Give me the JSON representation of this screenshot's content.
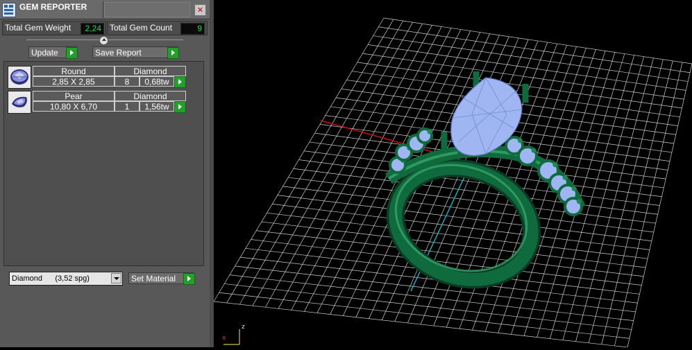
{
  "window": {
    "title": "GEM REPORTER",
    "close_glyph": "✕"
  },
  "summary": {
    "total_weight_label": "Total Gem Weight",
    "total_weight_value": "2,24",
    "total_count_label": "Total Gem Count",
    "total_count_value": "9"
  },
  "slider": {
    "icon": "slider-knob-icon"
  },
  "actions": {
    "update_label": "Update",
    "save_report_label": "Save Report"
  },
  "gems": [
    {
      "shape": "Round",
      "material": "Diamond",
      "size": "2,85 X 2,85",
      "count": "8",
      "weight": "0,68tw",
      "icon": "round-gem-icon"
    },
    {
      "shape": "Pear",
      "material": "Diamond",
      "size": "10,80 X 6,70",
      "count": "1",
      "weight": "1,56tw",
      "icon": "pear-gem-icon"
    }
  ],
  "material_select": {
    "value": "Diamond      (3,52 spg)"
  },
  "set_material_label": "Set Material",
  "viewport": {
    "axis_label": "z",
    "origin_label": "x"
  },
  "colors": {
    "panel": "#585858",
    "value_text": "#22dd44",
    "go_button": "#22a02a",
    "grid": "#d0d0d0",
    "metal": "#0f6b3e",
    "gem": "#9fb6f2",
    "x_axis": "#d01010",
    "y_axis": "#10b0c0"
  }
}
